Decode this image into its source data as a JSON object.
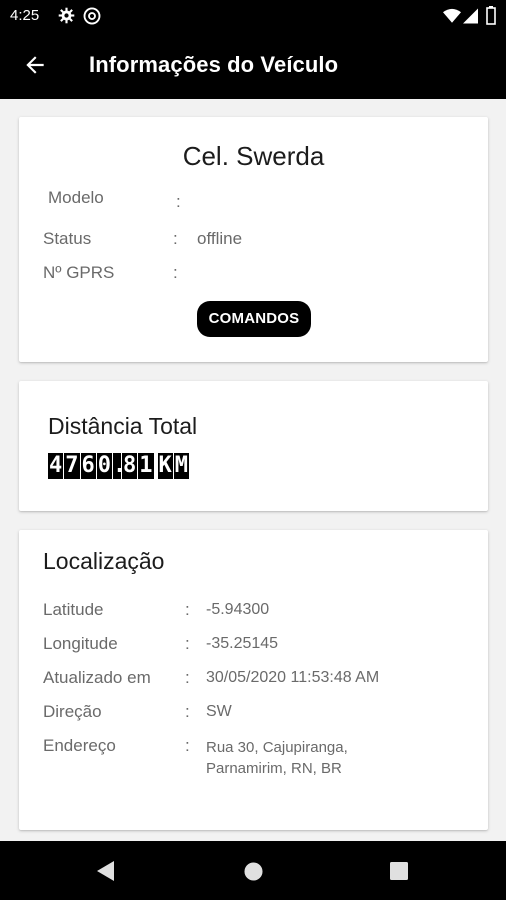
{
  "status_bar": {
    "time": "4:25",
    "icons": [
      "gear-icon",
      "at-icon",
      "wifi-icon",
      "signal-icon",
      "battery-icon"
    ]
  },
  "app_bar": {
    "title": "Informações do Veículo",
    "back_icon": "arrow-back-icon"
  },
  "vehicle_card": {
    "name": "Cel. Swerda",
    "rows": [
      {
        "label": "Modelo",
        "value": ""
      },
      {
        "label": "Status",
        "value": "offline"
      },
      {
        "label": "Nº GPRS",
        "value": ""
      }
    ],
    "colon": ":",
    "commands_button": "COMANDOS"
  },
  "distance_card": {
    "title": "Distância Total",
    "digits": [
      "4",
      "7",
      "6",
      "0",
      ".",
      "8",
      "1",
      "K",
      "M"
    ]
  },
  "location_card": {
    "title": "Localização",
    "rows": [
      {
        "label": "Latitude",
        "value": "-5.94300"
      },
      {
        "label": "Longitude",
        "value": "-35.25145"
      },
      {
        "label": "Atualizado em",
        "value": "30/05/2020 11:53:48 AM"
      },
      {
        "label": "Direção",
        "value": "SW"
      },
      {
        "label": "Endereço",
        "value_lines": [
          "Rua 30, Cajupiranga,",
          "Parnamirim, RN, BR"
        ]
      }
    ],
    "colon": ":"
  },
  "nav_bar": {
    "buttons": [
      "back-triangle-icon",
      "home-circle-icon",
      "recents-square-icon"
    ]
  },
  "colors": {
    "bar_background": "#000000",
    "page_background": "#f2f2f2",
    "card_background": "#ffffff",
    "label_text": "#6a6a6a"
  }
}
